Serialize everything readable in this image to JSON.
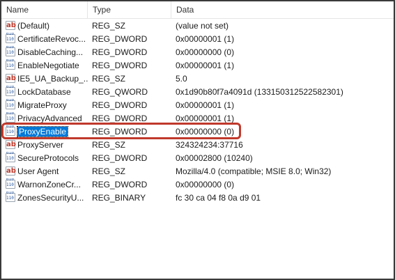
{
  "columns": {
    "name": "Name",
    "type": "Type",
    "data": "Data"
  },
  "rows": [
    {
      "icon": "string-value-icon",
      "kind": "sz",
      "name": "(Default)",
      "type": "REG_SZ",
      "data": "(value not set)"
    },
    {
      "icon": "binary-value-icon",
      "kind": "bin",
      "name": "CertificateRevoc...",
      "type": "REG_DWORD",
      "data": "0x00000001 (1)"
    },
    {
      "icon": "binary-value-icon",
      "kind": "bin",
      "name": "DisableCaching...",
      "type": "REG_DWORD",
      "data": "0x00000000 (0)"
    },
    {
      "icon": "binary-value-icon",
      "kind": "bin",
      "name": "EnableNegotiate",
      "type": "REG_DWORD",
      "data": "0x00000001 (1)"
    },
    {
      "icon": "string-value-icon",
      "kind": "sz",
      "name": "IE5_UA_Backup_...",
      "type": "REG_SZ",
      "data": "5.0"
    },
    {
      "icon": "binary-value-icon",
      "kind": "bin",
      "name": "LockDatabase",
      "type": "REG_QWORD",
      "data": "0x1d90b80f7a4091d (133150312522582301)"
    },
    {
      "icon": "binary-value-icon",
      "kind": "bin",
      "name": "MigrateProxy",
      "type": "REG_DWORD",
      "data": "0x00000001 (1)"
    },
    {
      "icon": "binary-value-icon",
      "kind": "bin",
      "name": "PrivacyAdvanced",
      "type": "REG_DWORD",
      "data": "0x00000001 (1)"
    },
    {
      "icon": "binary-value-icon",
      "kind": "bin",
      "name": "ProxyEnable",
      "type": "REG_DWORD",
      "data": "0x00000000 (0)",
      "selected": true
    },
    {
      "icon": "string-value-icon",
      "kind": "sz",
      "name": "ProxyServer",
      "type": "REG_SZ",
      "data": "324324234:37716"
    },
    {
      "icon": "binary-value-icon",
      "kind": "bin",
      "name": "SecureProtocols",
      "type": "REG_DWORD",
      "data": "0x00002800 (10240)"
    },
    {
      "icon": "string-value-icon",
      "kind": "sz",
      "name": "User Agent",
      "type": "REG_SZ",
      "data": "Mozilla/4.0 (compatible; MSIE 8.0; Win32)"
    },
    {
      "icon": "binary-value-icon",
      "kind": "bin",
      "name": "WarnonZoneCr...",
      "type": "REG_DWORD",
      "data": "0x00000000 (0)"
    },
    {
      "icon": "binary-value-icon",
      "kind": "bin",
      "name": "ZonesSecurityU...",
      "type": "REG_BINARY",
      "data": "fc 30 ca 04 f8 0a d9 01"
    }
  ],
  "colors": {
    "selection": "#0078d7",
    "highlight": "#c0392b"
  }
}
